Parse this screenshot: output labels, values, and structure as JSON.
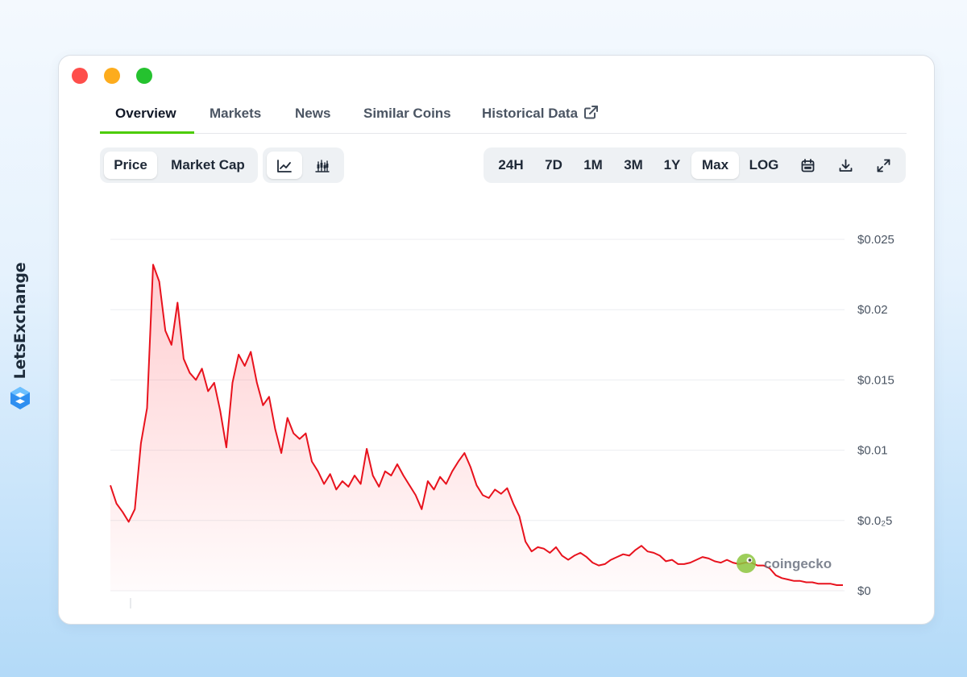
{
  "brand": {
    "name": "LetsExchange",
    "logo_icon": "letsexchange-logo-icon"
  },
  "window": {
    "controls": [
      "close-dot",
      "minimize-dot",
      "maximize-dot"
    ]
  },
  "tabs": [
    {
      "label": "Overview",
      "active": true
    },
    {
      "label": "Markets",
      "active": false
    },
    {
      "label": "News",
      "active": false
    },
    {
      "label": "Similar Coins",
      "active": false
    },
    {
      "label": "Historical Data",
      "active": false,
      "icon": "external-link-icon"
    }
  ],
  "toolbar": {
    "metric": {
      "price_label": "Price",
      "market_cap_label": "Market Cap",
      "selected": "Price"
    },
    "chart_style": {
      "line_icon": "line-chart-icon",
      "candle_icon": "candlestick-chart-icon",
      "selected": "line"
    },
    "ranges": [
      "24H",
      "7D",
      "1M",
      "3M",
      "1Y",
      "Max"
    ],
    "selected_range": "Max",
    "log_label": "LOG",
    "icons": {
      "calendar": "calendar-icon",
      "download": "download-icon",
      "fullscreen": "expand-icon"
    }
  },
  "watermark": "coingecko",
  "colors": {
    "line": "#e8121d",
    "accent": "#4bcc00",
    "grid": "#eceef1"
  },
  "chart_data": {
    "type": "area",
    "title": "",
    "xlabel": "",
    "ylabel": "",
    "ylim": [
      0,
      0.025
    ],
    "y_ticks": [
      "$0",
      "$0.0₂5",
      "$0.01",
      "$0.015",
      "$0.02",
      "$0.025"
    ],
    "y_tick_values": [
      0,
      0.005,
      0.01,
      0.015,
      0.02,
      0.025
    ],
    "grid": true,
    "series": [
      {
        "values": [
          0.0075,
          0.0062,
          0.0056,
          0.0049,
          0.0058,
          0.0105,
          0.013,
          0.0232,
          0.022,
          0.0185,
          0.0175,
          0.0205,
          0.0165,
          0.0155,
          0.015,
          0.0158,
          0.0142,
          0.0148,
          0.0128,
          0.0102,
          0.0148,
          0.0168,
          0.016,
          0.017,
          0.0148,
          0.0132,
          0.0138,
          0.0115,
          0.0098,
          0.0123,
          0.0112,
          0.0108,
          0.0112,
          0.0092,
          0.0085,
          0.0076,
          0.0083,
          0.0072,
          0.0078,
          0.0074,
          0.0082,
          0.0076,
          0.0101,
          0.0082,
          0.0074,
          0.0085,
          0.0082,
          0.009,
          0.0082,
          0.0075,
          0.0068,
          0.0058,
          0.0078,
          0.0072,
          0.0081,
          0.0076,
          0.0085,
          0.0092,
          0.0098,
          0.0088,
          0.0075,
          0.0068,
          0.0066,
          0.0072,
          0.0069,
          0.0073,
          0.0062,
          0.0053,
          0.0035,
          0.0028,
          0.0031,
          0.003,
          0.0027,
          0.0031,
          0.0025,
          0.0022,
          0.0025,
          0.0027,
          0.0024,
          0.002,
          0.0018,
          0.0019,
          0.0022,
          0.0024,
          0.0026,
          0.0025,
          0.0029,
          0.0032,
          0.0028,
          0.0027,
          0.0025,
          0.0021,
          0.0022,
          0.0019,
          0.0019,
          0.002,
          0.0022,
          0.0024,
          0.0023,
          0.0021,
          0.002,
          0.0022,
          0.002,
          0.0019,
          0.002,
          0.002,
          0.0018,
          0.0018,
          0.0016,
          0.0011,
          0.0009,
          0.0008,
          0.0007,
          0.0007,
          0.0006,
          0.0006,
          0.0005,
          0.0005,
          0.0005,
          0.0004,
          0.0004
        ]
      }
    ]
  }
}
